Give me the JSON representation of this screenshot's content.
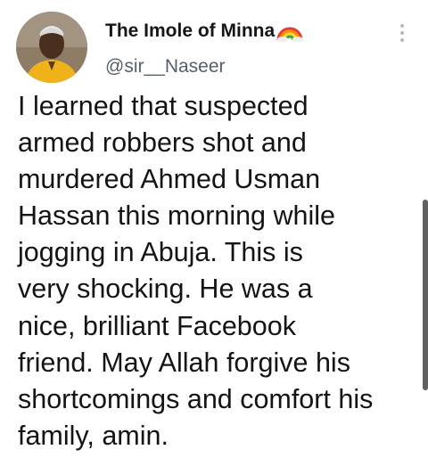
{
  "tweet": {
    "author": {
      "name": "The Imole of Minna",
      "name_icon": "rainbow-icon",
      "handle": "@sir__Naseer",
      "avatar_icon": "avatar-photo"
    },
    "more_icon": "vertical-dots-icon",
    "text_lines": [
      "I learned that suspected",
      "armed robbers shot and",
      "murdered Ahmed Usman",
      "Hassan this morning while",
      "jogging in Abuja. This is",
      "very shocking. He was a",
      "nice, brilliant Facebook",
      "friend. May Allah forgive his",
      "shortcomings and comfort his",
      "family, amin."
    ]
  },
  "colors": {
    "name": "#14171a",
    "handle": "#555f67",
    "text": "#141414",
    "scrollbar": "#5f5f5f"
  }
}
